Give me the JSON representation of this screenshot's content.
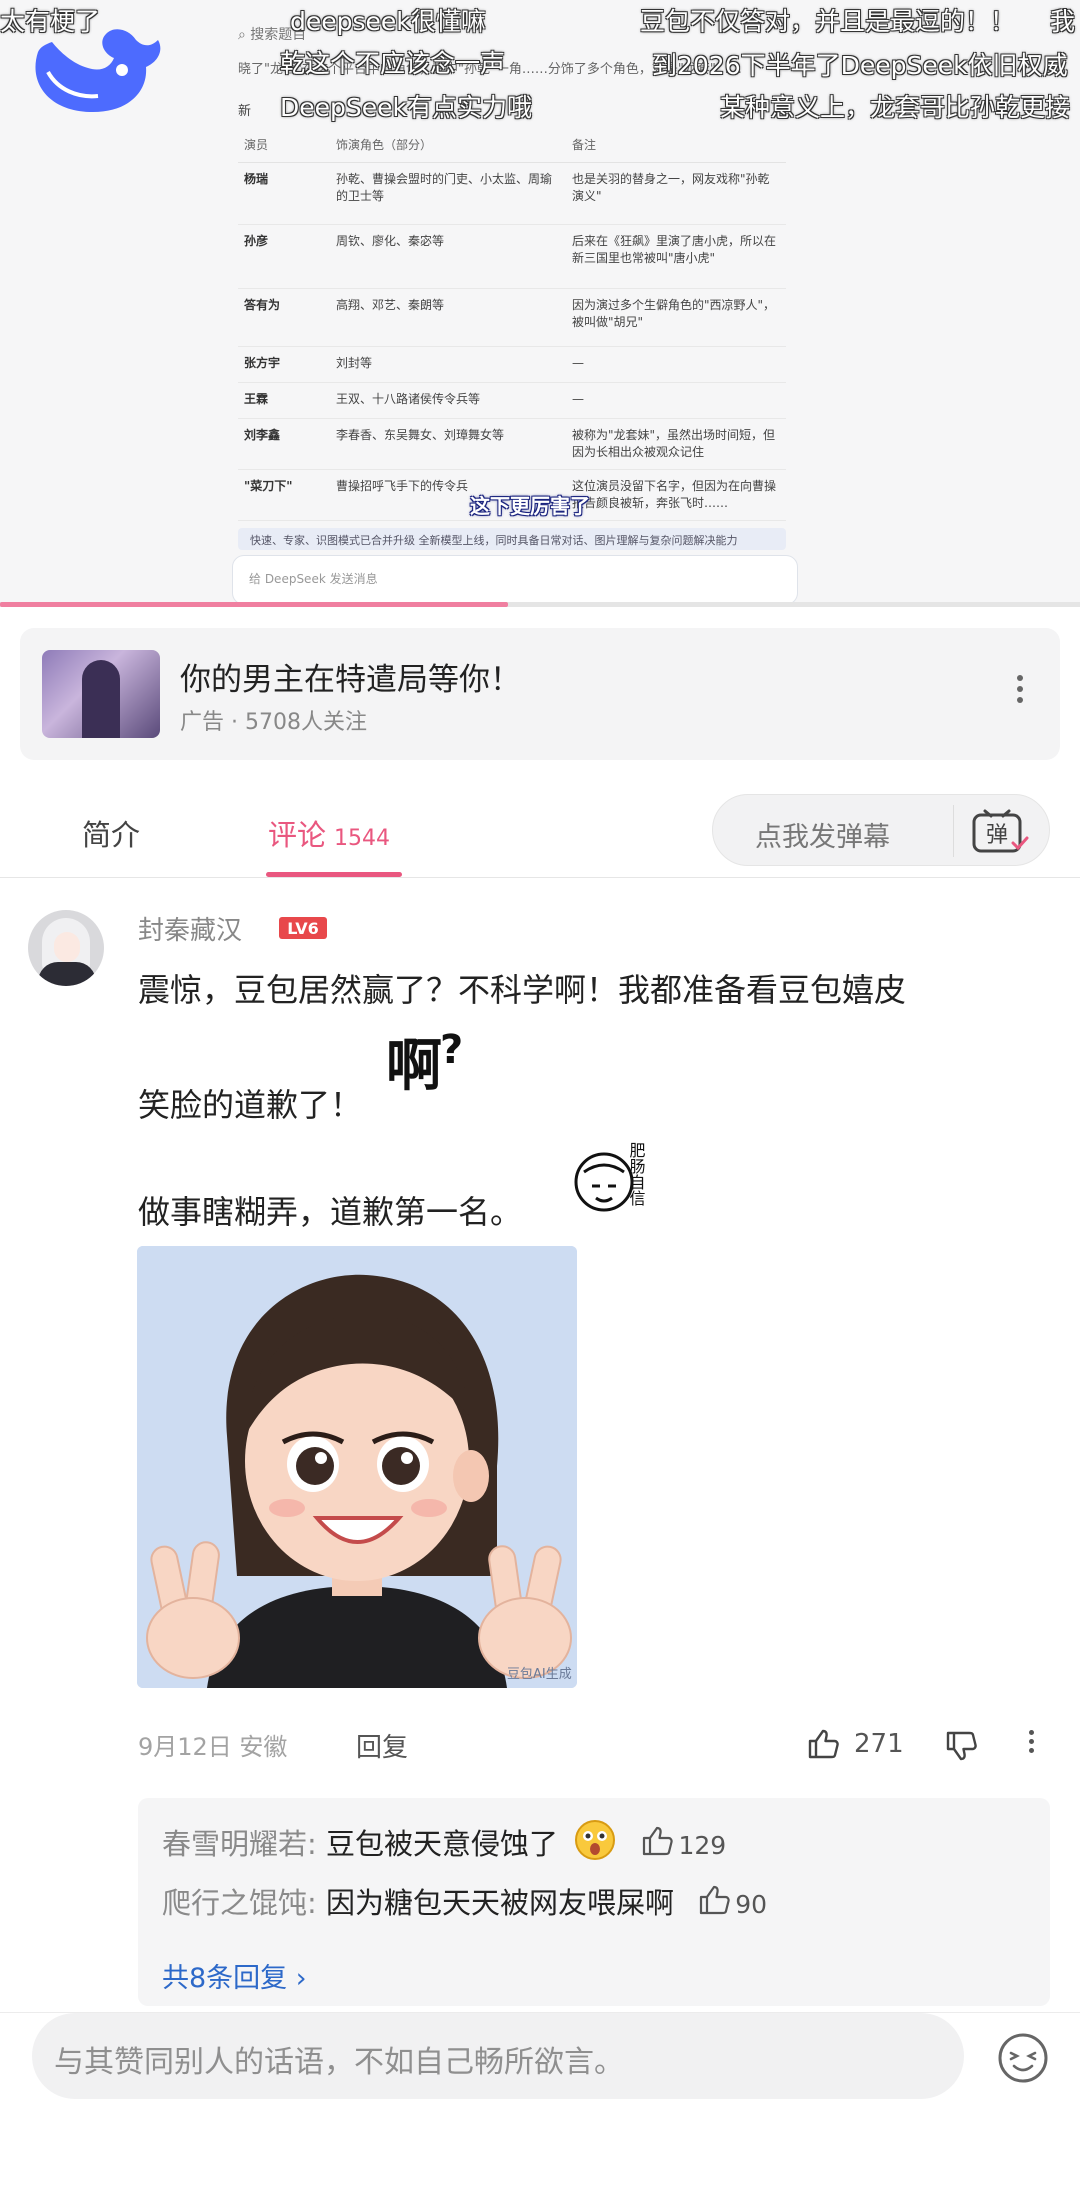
{
  "video": {
    "search_placeholder": "搜索题目",
    "shot_line1": "晓了\"龙套\"在这个平台中的角色，其中\"孙乾\"一角……分饰了多个角色，算是\"龙套\"……",
    "shot_line2": "新",
    "danmaku": [
      "太有梗了",
      "deepseek很懂嘛",
      "豆包不仅答对，并且是最逗的！！",
      "我",
      "乾这个不应该念一声",
      "到2026下半年了DeepSeek依旧权威",
      "DeepSeek有点实力哦",
      "某种意义上，龙套哥比孙乾更接"
    ],
    "table": {
      "headers": [
        "演员",
        "饰演角色（部分）",
        "备注"
      ],
      "rows": [
        [
          "杨瑞",
          "孙乾、曹操会盟时的门吏、小太监、周瑜的卫士等",
          "也是关羽的替身之一，网友戏称\"孙乾演义\""
        ],
        [
          "孙彦",
          "周钦、廖化、秦宓等",
          "后来在《狂飙》里演了唐小虎，所以在新三国里也常被叫\"唐小虎\""
        ],
        [
          "答有为",
          "高翔、邓艺、秦朗等",
          "因为演过多个生僻角色的\"西凉野人\"，被叫做\"胡兄\""
        ],
        [
          "张方宇",
          "刘封等",
          "—"
        ],
        [
          "王霖",
          "王双、十八路诸侯传令兵等",
          "—"
        ],
        [
          "刘李鑫",
          "李春香、东吴舞女、刘璋舞女等",
          "被称为\"龙套妹\"，虽然出场时间短，但因为长相出众被观众记住"
        ],
        [
          "\"菜刀下\"",
          "曹操招呼飞手下的传令兵",
          "这位演员没留下名字，但因为在向曹操报告颜良被斩，奔张飞时……"
        ]
      ]
    },
    "subtitle": "这下更厉害了",
    "notice": "快速、专家、识图模式已合并升级  全新模型上线，同时具备日常对话、图片理解与复杂问题解决能力",
    "input_placeholder": "给 DeepSeek 发送消息",
    "progress": 0.47
  },
  "ad": {
    "title": "你的男主在特遣局等你！",
    "meta": "广告 · 5708人关注"
  },
  "tabs": {
    "intro": "简介",
    "comments": "评论",
    "comments_count": "1544",
    "danmaku_placeholder": "点我发弹幕",
    "danmaku_icon_text": "弹"
  },
  "comment": {
    "username": "封秦藏汉",
    "level": "LV6",
    "line1": "震惊，豆包居然赢了？不科学啊！我都准备看豆包嬉皮",
    "line2": "笑脸的道歉了！",
    "line3": "做事瞎糊弄，道歉第一名。",
    "sticker1_text": "啊",
    "sticker2_text": "肥肠自信",
    "image_watermark": "豆包AI生成",
    "date_location": "9月12日 安徽",
    "reply_label": "回复",
    "like_count": "271"
  },
  "replies": {
    "items": [
      {
        "name": "春雪明耀若",
        "text": "豆包被天意侵蚀了",
        "likes": "129"
      },
      {
        "name": "爬行之馄饨",
        "text": "因为糖包天天被网友喂屎啊",
        "likes": "90"
      }
    ],
    "more_label": "共8条回复"
  },
  "input": {
    "placeholder": "与其赞同别人的话语，不如自己畅所欲言。"
  },
  "colors": {
    "accent": "#e9577f",
    "link": "#2d69c9",
    "level_badge": "#e8484b",
    "logo": "#4d6bfe"
  }
}
